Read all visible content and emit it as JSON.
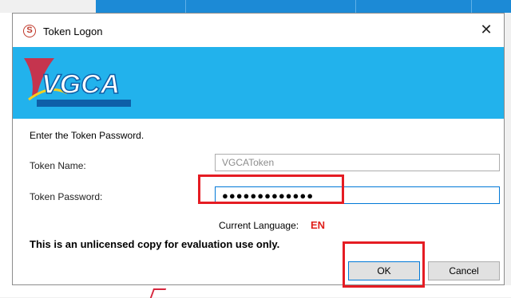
{
  "window": {
    "title": "Token Logon",
    "close_symbol": "✕"
  },
  "banner": {
    "logo_text": "VGCA",
    "logo_tagline": ""
  },
  "form": {
    "prompt": "Enter the Token Password.",
    "token_name_label": "Token Name:",
    "token_name_value": "VGCAToken",
    "token_password_label": "Token Password:",
    "token_password_value": "●●●●●●●●●●●●●",
    "current_language_label": "Current Language:",
    "current_language_value": "EN",
    "notice": "This is an unlicensed copy for evaluation use only."
  },
  "buttons": {
    "ok_label": "OK",
    "cancel_label": "Cancel"
  },
  "colors": {
    "banner": "#22b2ec",
    "highlight": "#e51c23",
    "language_value": "#e0201b",
    "focus_border": "#0078d7"
  }
}
